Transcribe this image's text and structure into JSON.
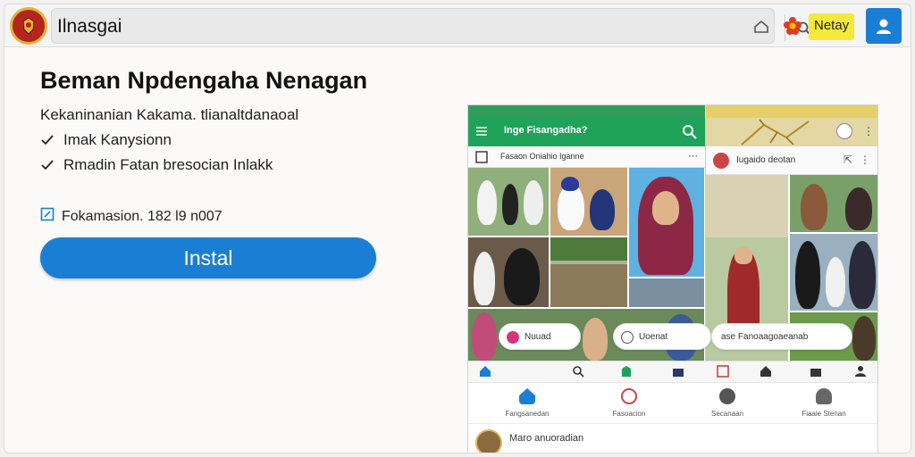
{
  "browser": {
    "address_text": "Ilnasgai",
    "badge_label": "Netay",
    "icons": [
      "home-icon",
      "search-icon",
      "flower-icon",
      "user-icon"
    ]
  },
  "colors": {
    "accent": "#1a7fd4",
    "logo_red": "#b3261e",
    "logo_gold": "#e8b23a",
    "badge_yellow": "#f5e93a",
    "phone_green": "#1fa35a"
  },
  "main": {
    "title": "Beman Npdengaha Nenagan",
    "subtitle": "Kekaninanian Kakama. tlianaltdanaoal",
    "features": [
      {
        "label": "Imak Kanysionn"
      },
      {
        "label": "Rmadin Fatan bresocian Inlakk"
      }
    ],
    "meta": "Fokamasion. 182 l9 n007",
    "install_label": "Instal"
  },
  "phone": {
    "appbar_title": "Inge Fisangadha?",
    "sub_left": "Fasaon Oniahio Iganne",
    "sub_right": "Iugaido deotan",
    "pill_left": "Nuuad",
    "pill_mid": "Uoenat",
    "pill_right": "ase Fanoaagoaeanab",
    "nav": [
      {
        "label": "Fangsanedan",
        "icon": "home-icon"
      },
      {
        "label": "Fasoacion",
        "icon": "chat-icon"
      },
      {
        "label": "Secanaan",
        "icon": "compass-icon"
      },
      {
        "label": "Fiaaie Stenan",
        "icon": "profile-icon"
      }
    ],
    "footer_text": "Maro anuoradian"
  }
}
